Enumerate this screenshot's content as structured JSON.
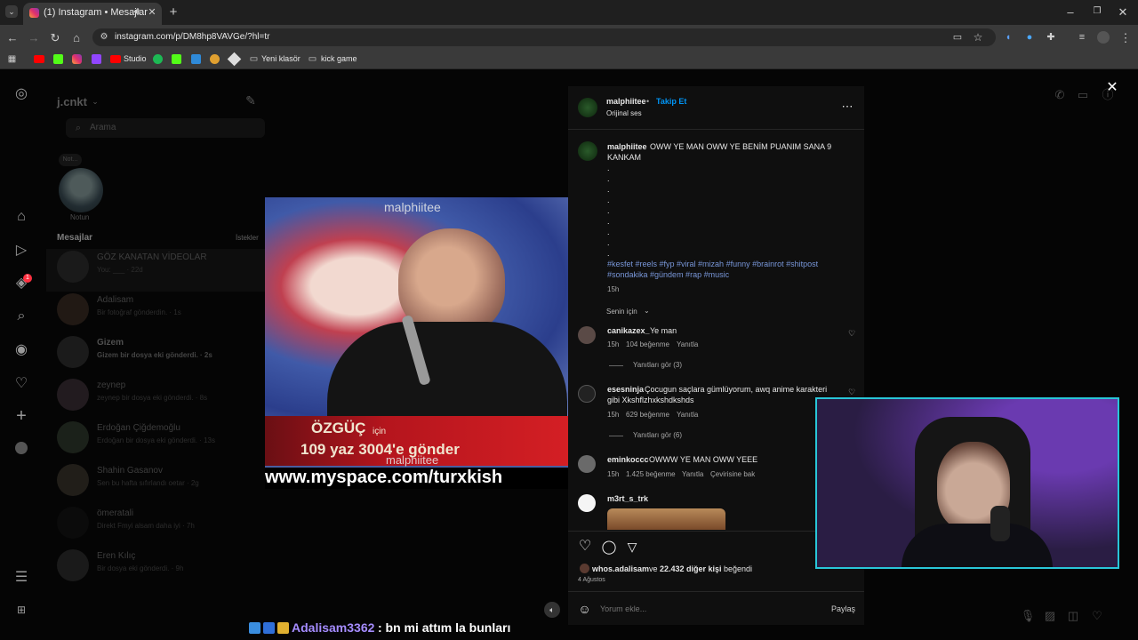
{
  "browser": {
    "tab_title": "(1) Instagram • Mesajlar",
    "url": "instagram.com/p/DM8hp8VAVGe/?hl=tr",
    "bookmarks": [
      {
        "label": "Studio"
      },
      {
        "label": "Yeni klasör"
      },
      {
        "label": "kick game"
      }
    ]
  },
  "dm": {
    "username": "j.cnkt",
    "search_placeholder": "Arama",
    "note_bubble": "Not...",
    "note_label": "Notun",
    "messages_header": "Mesajlar",
    "requests_label": "İstekler",
    "conversations": [
      {
        "name": "GÖZ KANATAN VİDEOLAR",
        "preview": "You: ___ · 22d"
      },
      {
        "name": "Adalisam",
        "preview": "Bir fotoğraf gönderdin. · 1s"
      },
      {
        "name": "Gizem",
        "preview": "Gizem bir dosya eki gönderdi. · 2s"
      },
      {
        "name": "zeynep",
        "preview": "zeynep bir dosya eki gönderdi. · 8s"
      },
      {
        "name": "Erdoğan Çiğdemoğlu",
        "preview": "Erdoğan bir dosya eki gönderdi. · 13s"
      },
      {
        "name": "Shahin Gasanov",
        "preview": "Sen bu hafta sıfırlandı oetar · 2g"
      },
      {
        "name": "ömeratali",
        "preview": "Direkt Fmyi alsam daha iyi · 7h"
      },
      {
        "name": "Eren Kılıç",
        "preview": "Bir dosya eki gönderdi. · 9h"
      }
    ],
    "notification_count": "1"
  },
  "video": {
    "watermark_top": "malphiitee",
    "watermark_bottom": "malphiitee",
    "banner_name": "ÖZGÜÇ",
    "banner_icin": "için",
    "banner_sms": "109  yaz 3004'e gönder",
    "site_url": "www.myspace.com/turxkish"
  },
  "post": {
    "author": "malphiitee",
    "follow_label": "Takip Et",
    "audio": "Orijinal ses",
    "caption_user": "malphiitee",
    "caption_text_line1": "OWW YE MAN OWW YE BENİM PUANIM SANA 9",
    "caption_text_line2": "KANKAM",
    "caption_dots": ".",
    "hashtags_line1": "#kesfet #reels #fyp #viral #mizah #funny #brainrot #shitpost",
    "hashtags_line2": "#sondakika #gündem #rap #music",
    "caption_time": "15h",
    "sort_label": "Senin için",
    "comments": [
      {
        "user": "canikazex_",
        "text": "Ye man",
        "time": "15h",
        "likes": "104 beğenme",
        "reply": "Yanıtla",
        "view_replies": "Yanıtları gör (3)"
      },
      {
        "user": "esesninja",
        "text": "Çocugun saçlara gümlüyorum, awq anime karakteri",
        "text2": "gibi Xkshflzhxkshdkshds",
        "time": "15h",
        "likes": "629 beğenme",
        "reply": "Yanıtla",
        "view_replies": "Yanıtları gör (6)"
      },
      {
        "user": "eminkoccc",
        "text": "OWWW YE MAN OWW YEEE",
        "time": "15h",
        "likes": "1.425 beğenme",
        "reply": "Yanıtla",
        "translate": "Çevirisine bak"
      },
      {
        "user": "m3rt_s_trk"
      }
    ],
    "liked_by_user": "whos.adalisam",
    "liked_by_rest_prefix": "ve",
    "liked_by_count": "22.432 diğer kişi",
    "liked_by_suffix": "beğendi",
    "date": "4 Ağustos",
    "comment_placeholder": "Yorum ekle...",
    "share_label": "Paylaş"
  },
  "stream_chat": {
    "user": "Adalisam3362",
    "message": ": bn mi attım la bunları",
    "user_color": "#a58cff"
  },
  "colors": {
    "accent": "#0095f6",
    "link": "#7896d8",
    "webcam_border": "#29c6d8"
  }
}
